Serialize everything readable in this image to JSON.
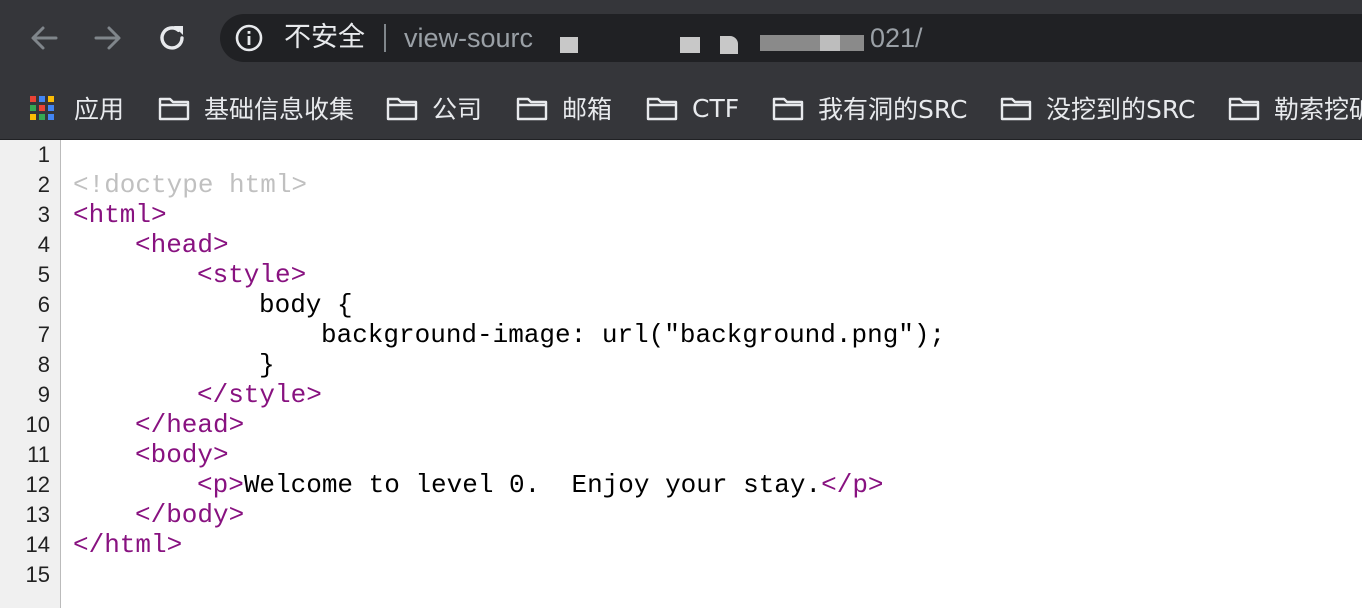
{
  "toolbar": {
    "back_icon": "arrow-left-icon",
    "forward_icon": "arrow-right-icon",
    "reload_icon": "reload-icon",
    "info_icon": "info-icon",
    "security_label": "不安全",
    "url_prefix": "view-sourc",
    "url_suffix": "021/"
  },
  "bookmarks": {
    "apps_label": "应用",
    "folders": [
      {
        "label": "基础信息收集",
        "icon": "folder-icon"
      },
      {
        "label": "公司",
        "icon": "folder-icon"
      },
      {
        "label": "邮箱",
        "icon": "folder-icon"
      },
      {
        "label": "CTF",
        "icon": "folder-icon"
      },
      {
        "label": "我有洞的SRC",
        "icon": "folder-icon"
      },
      {
        "label": "没挖到的SRC",
        "icon": "folder-icon"
      },
      {
        "label": "勒索挖矿",
        "icon": "folder-icon"
      }
    ]
  },
  "source": {
    "line_numbers": [
      "1",
      "2",
      "3",
      "4",
      "5",
      "6",
      "7",
      "8",
      "9",
      "10",
      "11",
      "12",
      "13",
      "14",
      "15"
    ],
    "lines": {
      "l2": "<!doctype html>",
      "l3": "<html>",
      "l4": "<head>",
      "l5": "<style>",
      "l6": "body {",
      "l7": "background-image: url(\"background.png\");",
      "l8": "}",
      "l9": "</style>",
      "l10": "</head>",
      "l11": "<body>",
      "l12_open": "<p>",
      "l12_text": "Welcome to level 0.  Enjoy your stay.",
      "l12_close": "</p>",
      "l13": "</body>",
      "l14": "</html>"
    }
  },
  "colors": {
    "toolbar_bg": "#35363a",
    "omnibox_bg": "#202124",
    "tag": "#881280",
    "doctype": "#c0c0c0"
  }
}
